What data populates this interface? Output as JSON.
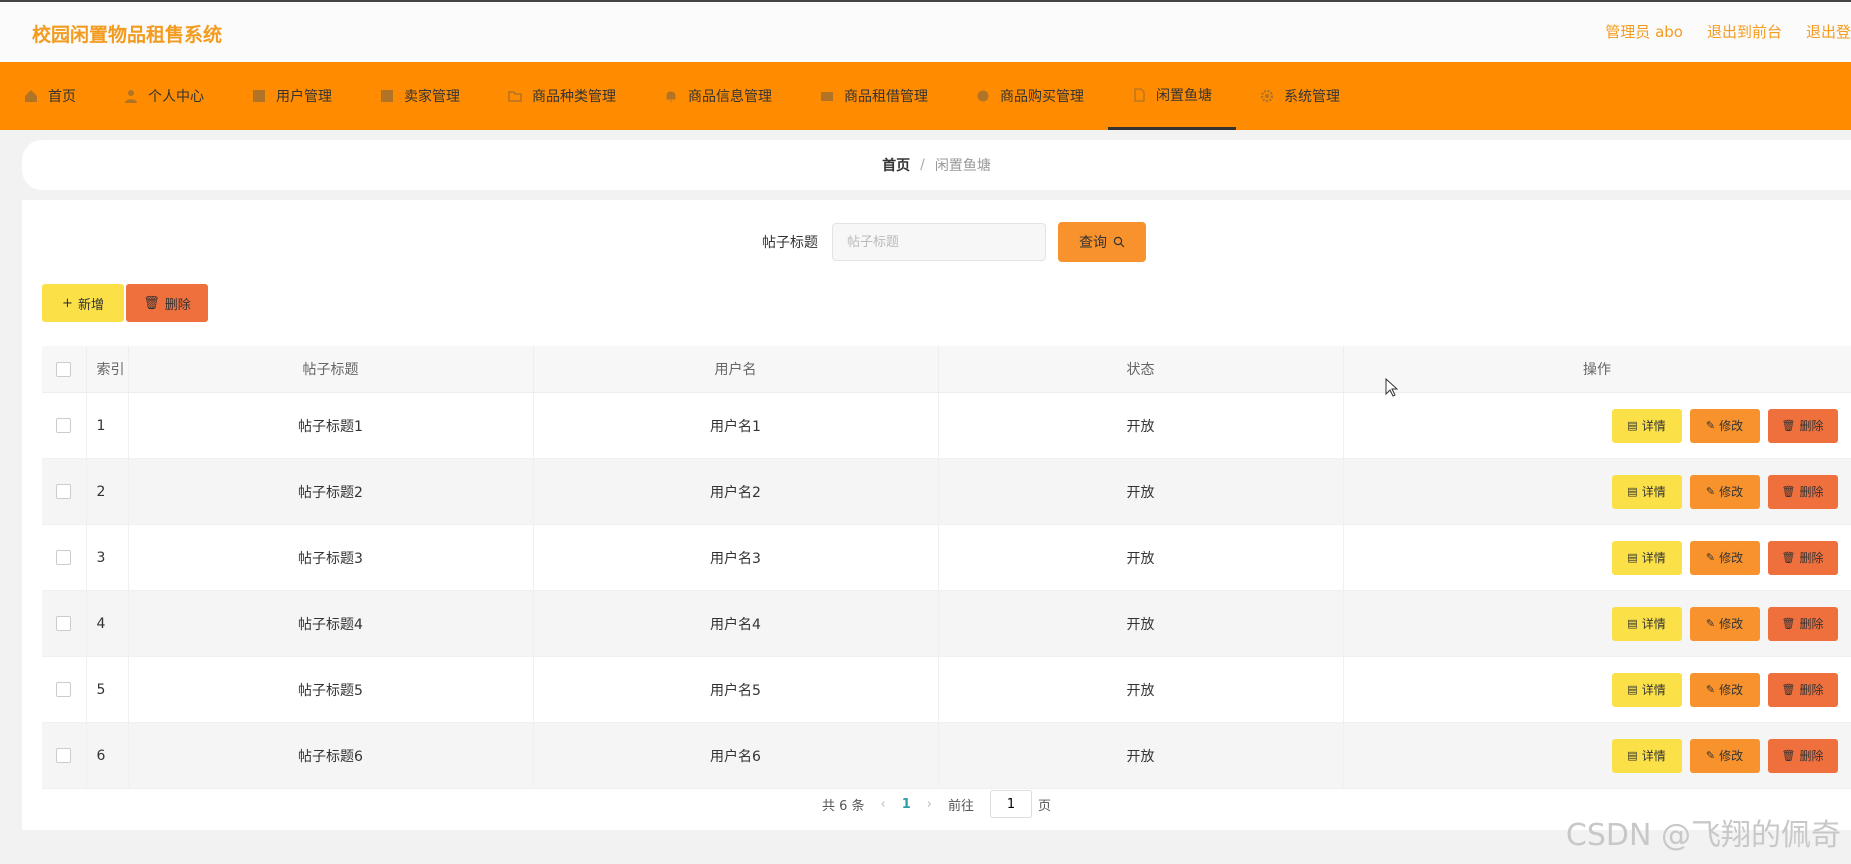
{
  "header": {
    "app_title": "校园闲置物品租售系统",
    "admin_label": "管理员 abo",
    "back_frontend": "退出到前台",
    "logout": "退出登"
  },
  "nav": {
    "items": [
      {
        "label": "首页",
        "icon": "home-icon"
      },
      {
        "label": "个人中心",
        "icon": "user-icon"
      },
      {
        "label": "用户管理",
        "icon": "table-icon"
      },
      {
        "label": "卖家管理",
        "icon": "table-icon"
      },
      {
        "label": "商品种类管理",
        "icon": "folder-icon"
      },
      {
        "label": "商品信息管理",
        "icon": "bell-icon"
      },
      {
        "label": "商品租借管理",
        "icon": "film-icon"
      },
      {
        "label": "商品购买管理",
        "icon": "cart-icon"
      },
      {
        "label": "闲置鱼塘",
        "icon": "document-icon"
      },
      {
        "label": "系统管理",
        "icon": "gear-icon"
      }
    ],
    "active_index": 8
  },
  "breadcrumb": {
    "home": "首页",
    "separator": "/",
    "current": "闲置鱼塘"
  },
  "search": {
    "label": "帖子标题",
    "placeholder": "帖子标题",
    "value": "",
    "button": "查询"
  },
  "toolbar": {
    "add_label": "新增",
    "delete_label": "删除"
  },
  "table": {
    "columns": [
      "索引",
      "帖子标题",
      "用户名",
      "状态",
      "操作"
    ],
    "rows": [
      {
        "index": "1",
        "title": "帖子标题1",
        "username": "用户名1",
        "status": "开放"
      },
      {
        "index": "2",
        "title": "帖子标题2",
        "username": "用户名2",
        "status": "开放"
      },
      {
        "index": "3",
        "title": "帖子标题3",
        "username": "用户名3",
        "status": "开放"
      },
      {
        "index": "4",
        "title": "帖子标题4",
        "username": "用户名4",
        "status": "开放"
      },
      {
        "index": "5",
        "title": "帖子标题5",
        "username": "用户名5",
        "status": "开放"
      },
      {
        "index": "6",
        "title": "帖子标题6",
        "username": "用户名6",
        "status": "开放"
      }
    ],
    "row_actions": {
      "detail": "详情",
      "edit": "修改",
      "delete": "删除"
    }
  },
  "pagination": {
    "total": "共 6 条",
    "current_page": "1",
    "goto_label": "前往",
    "goto_value": "1",
    "page_suffix": "页"
  },
  "watermark": "CSDN @飞翔的佩奇",
  "colors": {
    "accent": "#ff8c00",
    "title": "#f39b1f",
    "detail_btn": "#fbe147",
    "edit_btn": "#f7922d",
    "delete_btn": "#f0703d",
    "page_active": "#2ba0a9"
  }
}
